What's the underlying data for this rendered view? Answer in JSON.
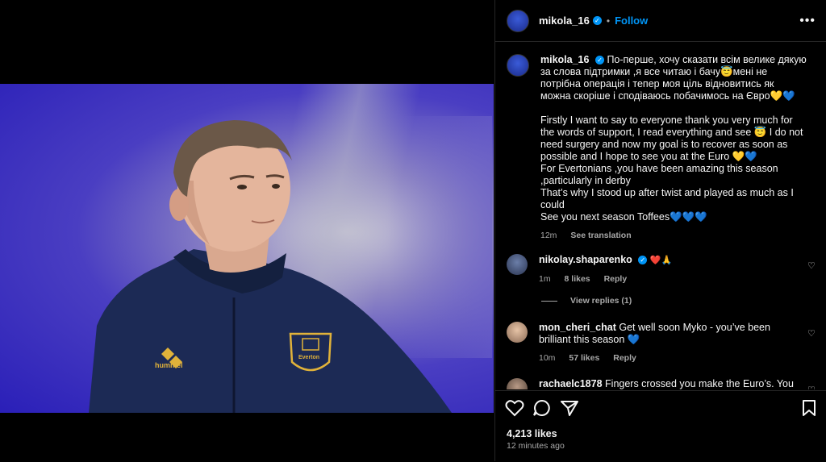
{
  "header": {
    "username": "mikola_16",
    "separator": "•",
    "follow_label": "Follow",
    "more_label": "•••"
  },
  "caption": {
    "username": "mikola_16",
    "text_ua": "По-перше, хочу сказати всім велике дякую за слова підтримки ,я все читаю і бачу😇мені не потрібна операція і тепер моя ціль відновитись як можна скоріше і сподіваюсь побачимось на Євро💛💙",
    "text_en_1": "Firstly I want to say to everyone thank you very much for the words of support, I read everything and see 😇 I do not need surgery and now my goal is to recover as soon as possible and I hope to see you at the Euro 💛💙",
    "text_en_2": "For Evertonians ,you have been amazing this season ,particularly in derby",
    "text_en_3": "That’s why I stood up after twist and played as much as I could",
    "text_en_4": "See you next season Toffees💙💙💙",
    "time": "12m",
    "see_translation": "See translation"
  },
  "comments": [
    {
      "username": "nikolay.shaparenko",
      "text": "❤️🙏",
      "time": "1m",
      "likes": "8 likes",
      "reply": "Reply",
      "view_replies": "View replies (1)"
    },
    {
      "username": "mon_cheri_chat",
      "text": "Get well soon Myko - you’ve been brilliant this season 💙",
      "time": "10m",
      "likes": "57 likes",
      "reply": "Reply"
    },
    {
      "username": "rachaelc1878",
      "text": "Fingers crossed you make the Euro’s. You"
    }
  ],
  "footer": {
    "likes": "4,213 likes",
    "ago": "12 minutes ago"
  },
  "photo": {
    "shirt_brand": "hummel",
    "crest_text": "Everton"
  },
  "colors": {
    "accent": "#0095f6",
    "background": "#000000",
    "kit_navy": "#1c2a55",
    "kit_gold": "#e0b23a"
  }
}
